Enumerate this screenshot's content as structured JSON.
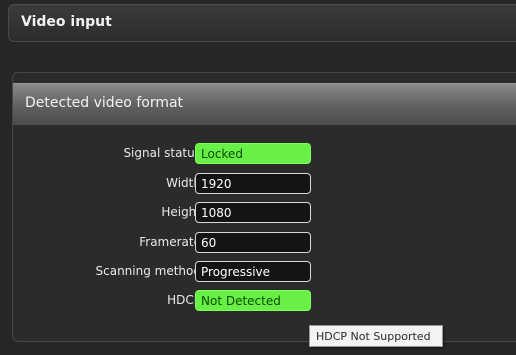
{
  "top_panel": {
    "title": "Video input"
  },
  "section": {
    "title": "Detected video format",
    "rows": [
      {
        "label": "Signal status",
        "value": "Locked",
        "status_color": "#68f047"
      },
      {
        "label": "Width",
        "value": "1920"
      },
      {
        "label": "Height",
        "value": "1080"
      },
      {
        "label": "Framerate",
        "value": "60"
      },
      {
        "label": "Scanning method",
        "value": "Progressive"
      },
      {
        "label": "HDCP",
        "value": "Not Detected",
        "status_color": "#68f047"
      }
    ]
  },
  "tooltip": {
    "text": "HDCP Not Supported"
  }
}
